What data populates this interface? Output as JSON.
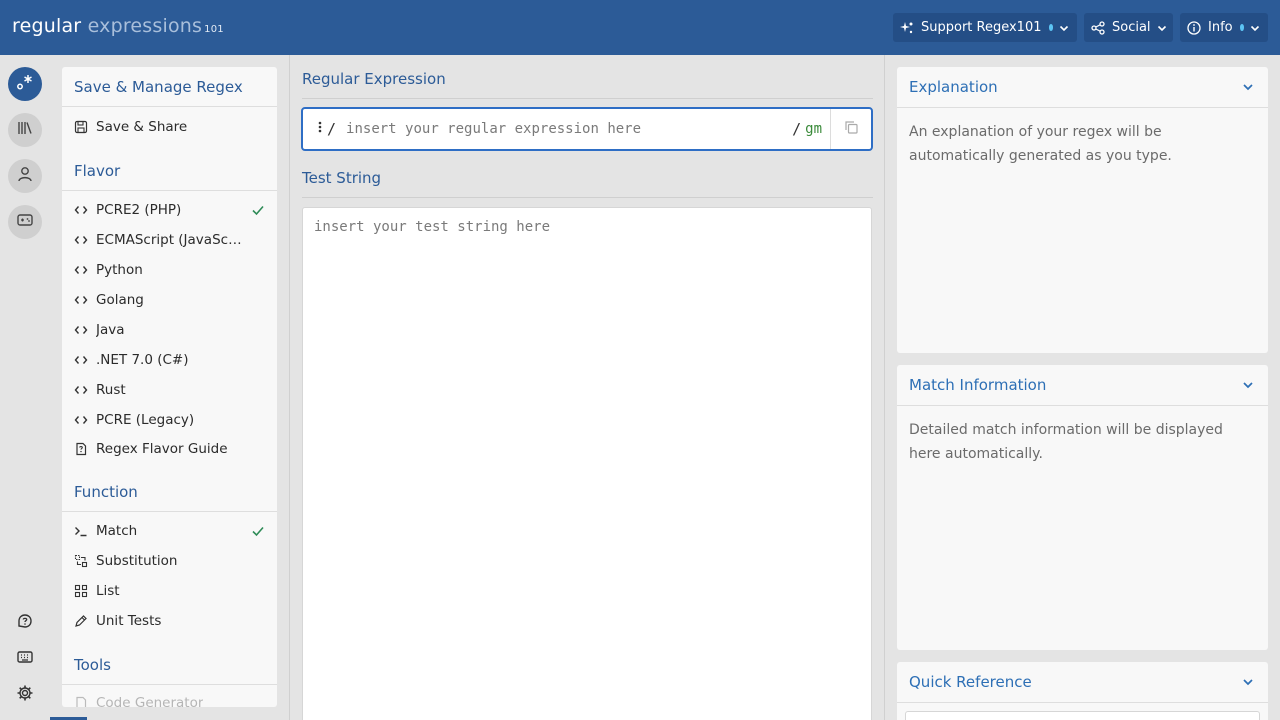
{
  "header": {
    "logo_part1": "regular",
    "logo_part2": " expressions",
    "logo_part3": "101",
    "support_label": "Support Regex101",
    "social_label": "Social",
    "info_label": "Info"
  },
  "rail": {
    "icons": [
      "regex-icon",
      "library-icon",
      "user-icon",
      "quiz-icon",
      "help-icon",
      "keyboard-icon",
      "gear-icon"
    ]
  },
  "sidebar": {
    "save_heading": "Save & Manage Regex",
    "save_share": "Save & Share",
    "flavor_heading": "Flavor",
    "flavors": [
      {
        "label": "PCRE2 (PHP)",
        "selected": true
      },
      {
        "label": "ECMAScript (JavaScript)",
        "selected": false
      },
      {
        "label": "Python",
        "selected": false
      },
      {
        "label": "Golang",
        "selected": false
      },
      {
        "label": "Java",
        "selected": false
      },
      {
        "label": ".NET 7.0 (C#)",
        "selected": false
      },
      {
        "label": "Rust",
        "selected": false
      },
      {
        "label": "PCRE (Legacy)",
        "selected": false
      }
    ],
    "flavor_guide": "Regex Flavor Guide",
    "function_heading": "Function",
    "functions": [
      {
        "label": "Match",
        "selected": true
      },
      {
        "label": "Substitution",
        "selected": false
      },
      {
        "label": "List",
        "selected": false
      },
      {
        "label": "Unit Tests",
        "selected": false
      }
    ],
    "tools_heading": "Tools",
    "code_generator": "Code Generator"
  },
  "main": {
    "regex_title": "Regular Expression",
    "regex_open": "/",
    "regex_placeholder": "insert your regular expression here",
    "regex_close": "/",
    "regex_flags": "gm",
    "test_title": "Test String",
    "test_placeholder": "insert your test string here"
  },
  "right": {
    "explanation_title": "Explanation",
    "explanation_text": "An explanation of your regex will be automatically generated as you type.",
    "match_info_title": "Match Information",
    "match_info_text": "Detailed match information will be displayed here automatically.",
    "quick_ref_title": "Quick Reference"
  },
  "colors": {
    "header_bg": "#2c5b97",
    "accent_blue": "#2d6fb5",
    "check_green": "#2e8b57",
    "flag_green": "#3a8a3a",
    "status_dot": "#5cc4f4"
  }
}
